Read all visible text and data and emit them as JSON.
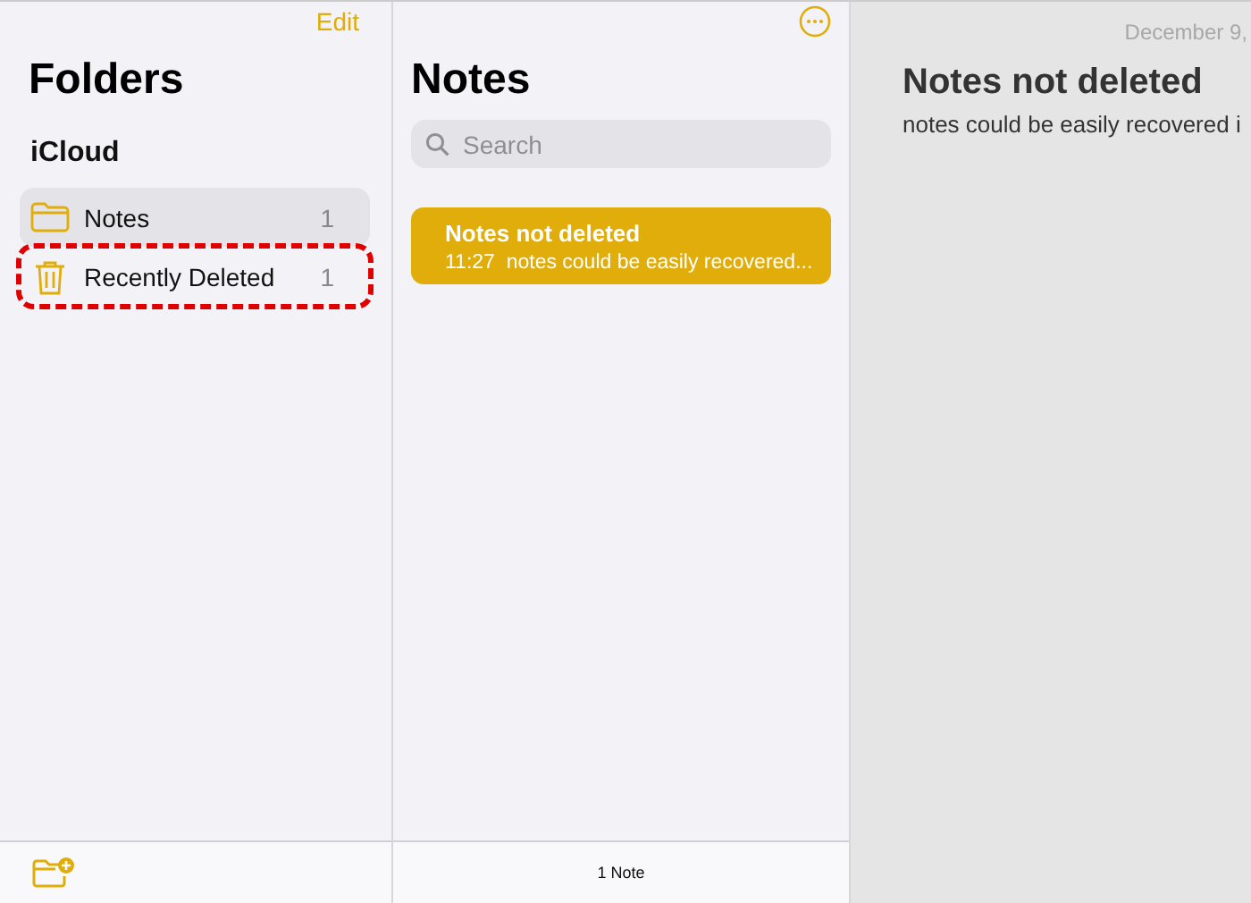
{
  "sidebar": {
    "edit_label": "Edit",
    "title": "Folders",
    "section": "iCloud",
    "folders": [
      {
        "kind": "folder",
        "name": "Notes",
        "count": "1",
        "selected": true,
        "highlighted": false
      },
      {
        "kind": "trash",
        "name": "Recently Deleted",
        "count": "1",
        "selected": false,
        "highlighted": true
      }
    ]
  },
  "note_list": {
    "title": "Notes",
    "search": {
      "placeholder": "Search"
    },
    "notes": [
      {
        "title": "Notes not deleted",
        "time": "11:27",
        "preview": "notes could be easily recovered...",
        "selected": true
      }
    ],
    "footer": "1 Note"
  },
  "detail": {
    "date": "December 9,",
    "title": "Notes not deleted",
    "body": "notes could be easily recovered i"
  }
}
